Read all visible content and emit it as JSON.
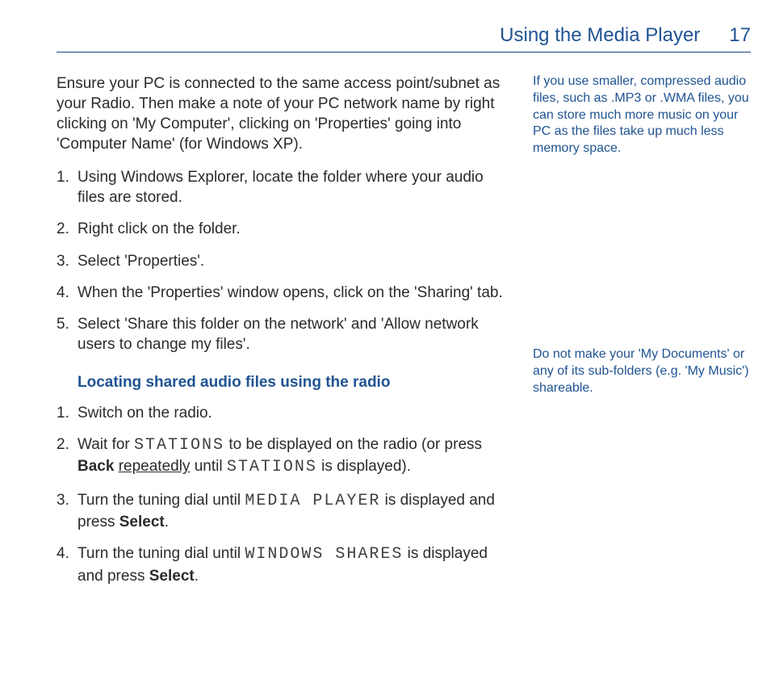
{
  "header": {
    "title": "Using the Media Player",
    "pageno": "17"
  },
  "intro": "Ensure your PC is connected to the same access point/subnet as your Radio. Then make a note of your PC network name by right clicking on 'My Computer', clicking on 'Properties' going into 'Computer Name' (for Windows XP).",
  "steps1": {
    "n1": "1.",
    "t1": "Using Windows Explorer, locate the folder where your audio files are stored.",
    "n2": "2.",
    "t2": "Right click on the folder.",
    "n3": "3.",
    "t3": "Select 'Properties'.",
    "n4": "4.",
    "t4": "When the 'Properties' window opens, click on the 'Sharing' tab.",
    "n5": "5.",
    "t5": "Select 'Share this folder on the network' and 'Allow network users to change my files'."
  },
  "subhead": "Locating shared audio files using the radio",
  "steps2": {
    "n1": "1.",
    "t1": "Switch on the radio.",
    "n2": "2.",
    "t2a": "Wait for ",
    "lcd2a": "STATIONS",
    "t2b": " to be displayed on the radio (or press ",
    "bold2": "Back",
    "t2c": " ",
    "under2": "repeatedly",
    "t2d": " until ",
    "lcd2b": "STATIONS",
    "t2e": " is displayed).",
    "n3": "3.",
    "t3a": "Turn the tuning dial until ",
    "lcd3": "MEDIA PLAYER",
    "t3b": " is displayed and",
    "t3c": "press ",
    "bold3": "Select",
    "t3d": ".",
    "n4": "4.",
    "t4a": "Turn the tuning dial until ",
    "lcd4": "WINDOWS SHARES",
    "t4b": " is displayed and press ",
    "bold4": "Select",
    "t4c": "."
  },
  "side": {
    "note1": "If you use smaller, compressed audio files, such as .MP3 or .WMA files, you can store much more music on your PC as the files take up much less memory space.",
    "note2": "Do not make your 'My Documents' or any of its sub-folders (e.g. 'My Music') shareable."
  }
}
